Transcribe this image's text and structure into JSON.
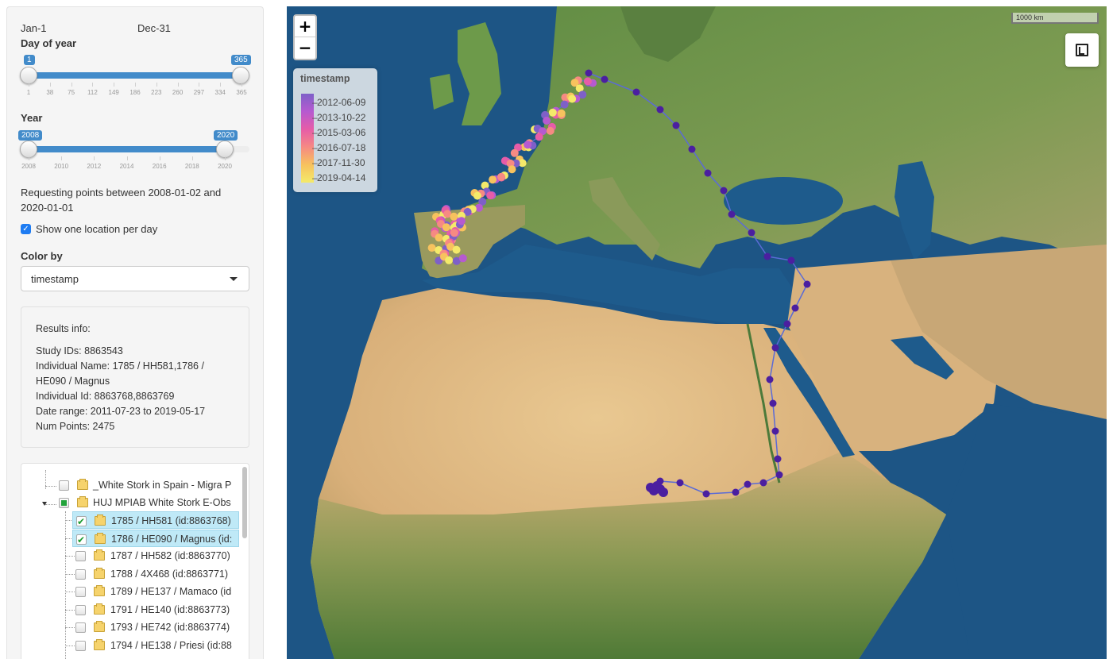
{
  "day_slider": {
    "start_label": "Jan-1",
    "end_label": "Dec-31",
    "title": "Day of year",
    "from": 1,
    "to": 365,
    "min": 1,
    "max": 365,
    "ticks": [
      "1",
      "38",
      "75",
      "112",
      "149",
      "186",
      "223",
      "260",
      "297",
      "334",
      "365"
    ]
  },
  "year_slider": {
    "title": "Year",
    "from": 2008,
    "to": 2020,
    "min": 2008,
    "max": 2021,
    "ticks": [
      "2008",
      "2010",
      "2012",
      "2014",
      "2016",
      "2018",
      "2020"
    ]
  },
  "request_text": "Requesting points between 2008-01-02 and 2020-01-01",
  "one_per_day": {
    "label": "Show one location per day",
    "checked": true
  },
  "color_by": {
    "label": "Color by",
    "value": "timestamp"
  },
  "results": {
    "header": "Results info:",
    "lines": [
      "Study IDs: 8863543",
      "Individual Name: 1785 / HH581,1786 / HE090 / Magnus",
      "Individual Id: 8863768,8863769",
      "Date range: 2011-07-23 to 2019-05-17",
      "Num Points: 2475"
    ]
  },
  "tree": {
    "studies": [
      {
        "label": "_White Stork in Spain - Migra P",
        "state": "unchecked"
      },
      {
        "label": "HUJ MPIAB White Stork E-Obs",
        "state": "partial"
      }
    ],
    "individuals": [
      {
        "label": "1785 / HH581 (id:8863768)",
        "checked": true
      },
      {
        "label": "1786 / HE090 / Magnus (id:",
        "checked": true
      },
      {
        "label": "1787 / HH582 (id:8863770)",
        "checked": false
      },
      {
        "label": "1788 / 4X468 (id:8863771)",
        "checked": false
      },
      {
        "label": "1789 / HE137 / Mamaco (id",
        "checked": false
      },
      {
        "label": "1791 / HE140 (id:8863773)",
        "checked": false
      },
      {
        "label": "1793 / HE742 (id:8863774)",
        "checked": false
      },
      {
        "label": "1794 / HE138 / Priesi (id:88",
        "checked": false
      }
    ]
  },
  "map": {
    "zoom_in": "+",
    "zoom_out": "−",
    "scale": "1000 km",
    "legend": {
      "title": "timestamp",
      "labels": [
        "2012-06-09",
        "2013-10-22",
        "2015-03-06",
        "2016-07-18",
        "2017-11-30",
        "2019-04-14"
      ],
      "colors": [
        "#7e60c8",
        "#b65ad0",
        "#e65ca8",
        "#f68a83",
        "#f7c25e",
        "#f4ea6a"
      ]
    }
  },
  "colors": {
    "accent": "#428bca",
    "track_dark": "#4b1fa0",
    "track_line": "#5b6bd6"
  }
}
